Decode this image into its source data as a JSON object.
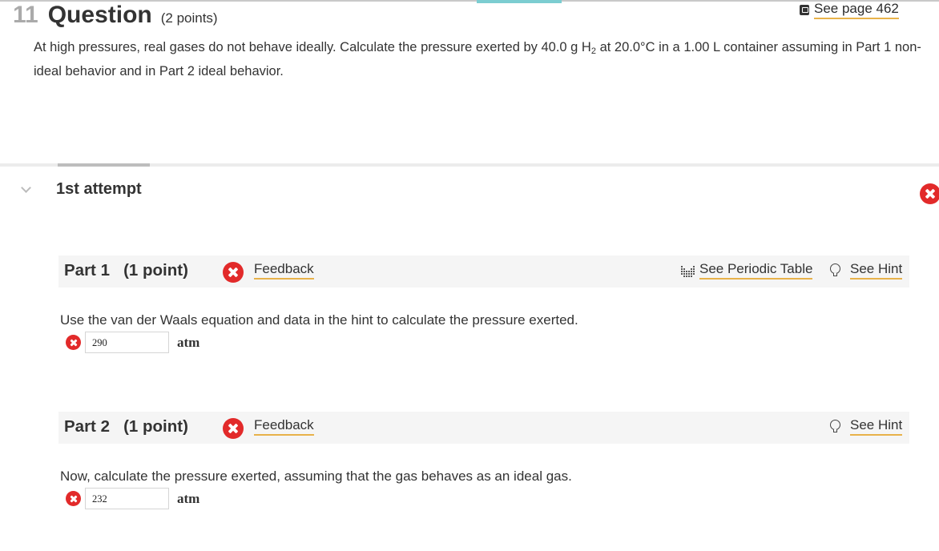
{
  "question": {
    "number": "11",
    "title": "Question",
    "points": "(2 points)",
    "see_page": "See page 462",
    "prompt_a": "At high pressures, real gases do not behave ideally. Calculate the pressure exerted by 40.0 g H",
    "prompt_sub": "2",
    "prompt_b": " at 20.0°C in a 1.00 L container assuming in Part 1 non-ideal behavior and in Part 2 ideal behavior."
  },
  "attempt": {
    "label": "1st attempt"
  },
  "part1": {
    "label": "Part 1",
    "points": "(1 point)",
    "feedback": "Feedback",
    "periodic_table": "See Periodic Table",
    "hint": "See Hint",
    "question": "Use the van der Waals equation and data in the hint to calculate the pressure exerted.",
    "answer": "290",
    "unit": "atm"
  },
  "part2": {
    "label": "Part 2",
    "points": "(1 point)",
    "feedback": "Feedback",
    "hint": "See Hint",
    "question": "Now, calculate the pressure exerted, assuming that the gas behaves as an ideal gas.",
    "answer": "232",
    "unit": "atm"
  },
  "icons": {
    "incorrect": "x-circle-icon",
    "ebook": "ebook-icon",
    "periodic_table": "periodic-table-icon",
    "hint": "lightbulb-icon",
    "expand": "chevron-down-icon"
  },
  "colors": {
    "incorrect": "#e22a2a",
    "link_underline": "#e8b24a",
    "tab_accent": "#7ccdd1"
  }
}
